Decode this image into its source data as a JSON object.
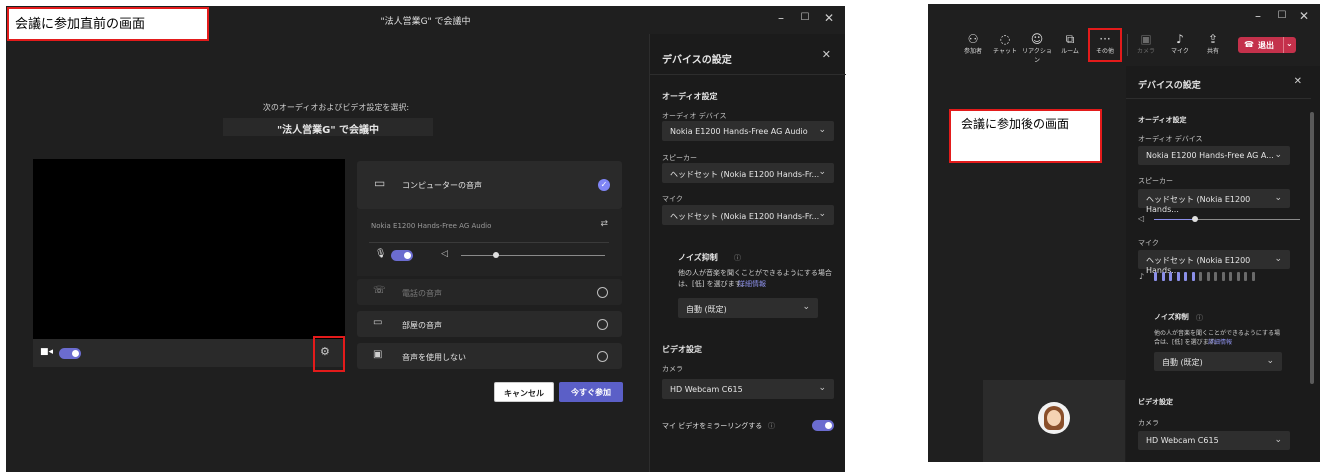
{
  "labels": {
    "before": "会議に参加直前の画面",
    "after": "会議に参加後の画面"
  },
  "prejoin": {
    "window_title": "\"法人営業G\" で会議中",
    "window_controls": [
      "–",
      "☐",
      "✕"
    ],
    "prompt": "次のオーディオおよびビデオ設定を選択:",
    "meeting_name": "\"法人営業G\" で会議中",
    "audio_options": {
      "computer": "コンピューターの音声",
      "device_name": "Nokia E1200 Hands-Free AG Audio",
      "phone": "電話の音声",
      "room": "部屋の音声",
      "none": "音声を使用しない"
    },
    "cancel_label": "キャンセル",
    "join_label": "今すぐ参加"
  },
  "settings1": {
    "title": "デバイスの設定",
    "audio_heading": "オーディオ設定",
    "audio_device_label": "オーディオ デバイス",
    "audio_device_value": "Nokia E1200 Hands-Free AG Audio",
    "speaker_label": "スピーカー",
    "speaker_value": "ヘッドセット (Nokia E1200 Hands-Fr...",
    "mic_label": "マイク",
    "mic_value": "ヘッドセット (Nokia E1200 Hands-Fr...",
    "noise_title": "ノイズ抑制",
    "noise_desc_1": "他の人が音楽を聞くことができるようにする場合",
    "noise_desc_2": "は、[低] を選びます。",
    "noise_link": "詳細情報",
    "noise_value": "自動 (既定)",
    "video_heading": "ビデオ設定",
    "camera_label": "カメラ",
    "camera_value": "HD Webcam C615",
    "mirror_label": "マイ ビデオをミラーリングする"
  },
  "meeting": {
    "window_controls": [
      "–",
      "☐",
      "✕"
    ],
    "toolbar": [
      {
        "label": "参加者",
        "icon": "people-icon"
      },
      {
        "label": "チャット",
        "icon": "chat-icon"
      },
      {
        "label": "リアクション",
        "icon": "reaction-icon"
      },
      {
        "label": "ルーム",
        "icon": "rooms-icon"
      },
      {
        "label": "その他",
        "icon": "more-icon"
      },
      {
        "label": "カメラ",
        "icon": "camera-off-icon"
      },
      {
        "label": "マイク",
        "icon": "mic-icon"
      },
      {
        "label": "共有",
        "icon": "share-icon"
      }
    ],
    "leave_label": "退出"
  },
  "settings2": {
    "title": "デバイスの設定",
    "audio_heading": "オーディオ設定",
    "audio_device_label": "オーディオ デバイス",
    "audio_device_value": "Nokia E1200 Hands-Free AG A...",
    "speaker_label": "スピーカー",
    "speaker_value": "ヘッドセット (Nokia E1200 Hands...",
    "mic_label": "マイク",
    "mic_value": "ヘッドセット (Nokia E1200 Hands...",
    "noise_title": "ノイズ抑制",
    "noise_desc_1": "他の人が音楽を聞くことができるようにする場",
    "noise_desc_2": "合は、[低] を選びます。",
    "noise_link": "詳細情報",
    "noise_value": "自動 (既定)",
    "video_heading": "ビデオ設定",
    "camera_label": "カメラ",
    "camera_value": "HD Webcam C615"
  },
  "colors": {
    "accent": "#6b6ccf",
    "leave": "#c4314b",
    "highlight": "#e31b1b"
  }
}
